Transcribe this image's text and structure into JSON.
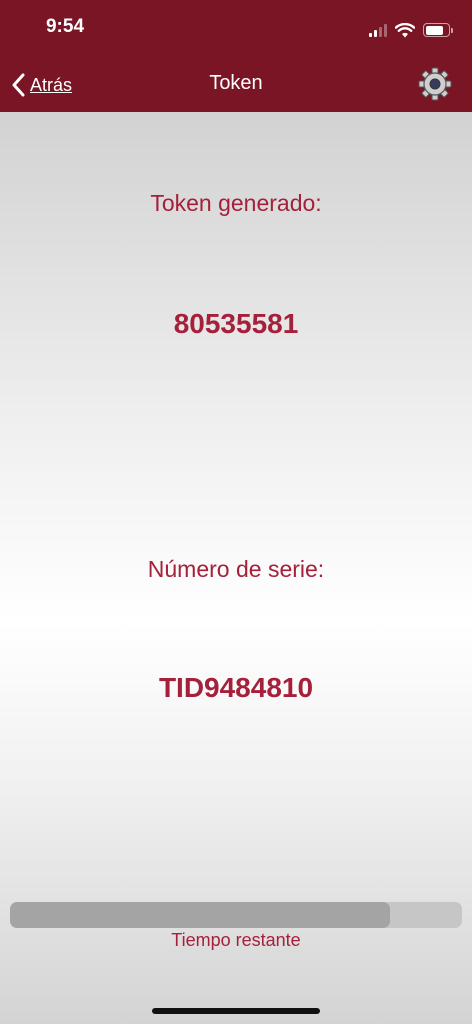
{
  "status_bar": {
    "time": "9:54",
    "battery_level": 0.8
  },
  "nav": {
    "back_label": "Atrás",
    "title": "Token",
    "settings_icon": "gear-icon"
  },
  "token": {
    "label": "Token generado:",
    "value": "80535581"
  },
  "serial": {
    "label": "Número de serie:",
    "value": "TID9484810"
  },
  "timer": {
    "label": "Tiempo restante",
    "remaining_fraction": 0.84
  },
  "colors": {
    "brand": "#7a1526",
    "accent_text": "#a5203a"
  }
}
